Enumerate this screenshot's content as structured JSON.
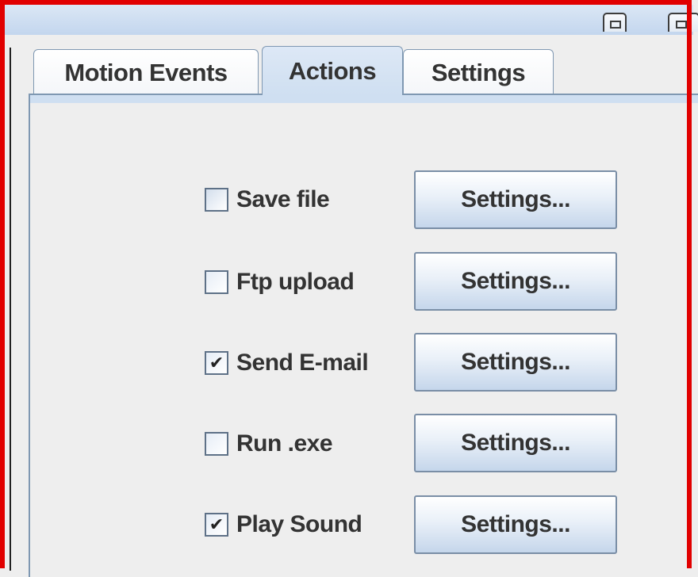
{
  "tabs": [
    {
      "label": "Motion Events",
      "selected": false
    },
    {
      "label": "Actions",
      "selected": true
    },
    {
      "label": "Settings",
      "selected": false
    }
  ],
  "actions": [
    {
      "label": "Save file",
      "checked": false,
      "button_label": "Settings..."
    },
    {
      "label": "Ftp upload",
      "checked": false,
      "button_label": "Settings..."
    },
    {
      "label": "Send E-mail",
      "checked": true,
      "button_label": "Settings..."
    },
    {
      "label": "Run .exe",
      "checked": false,
      "button_label": "Settings..."
    },
    {
      "label": "Play Sound",
      "checked": true,
      "button_label": "Settings..."
    }
  ],
  "colors": {
    "highlight_frame": "#e10000",
    "selected_tab": "#cfdff1",
    "panel_background": "#eeeeee",
    "border": "#7f98b2"
  },
  "icons": {
    "checkmark": "checkmark-icon",
    "minimize": "minimize-icon",
    "maximize": "maximize-icon"
  }
}
